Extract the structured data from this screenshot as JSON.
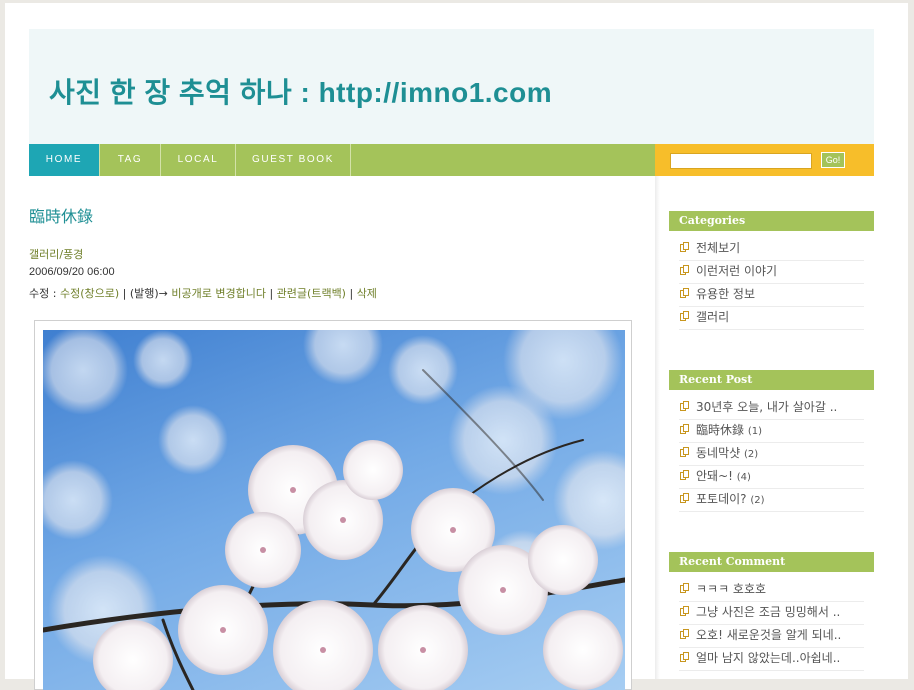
{
  "site": {
    "title": "사진 한 장 추억 하나 : http://imno1.com"
  },
  "nav": {
    "items": [
      {
        "label": "HOME",
        "active": true
      },
      {
        "label": "TAG",
        "active": false
      },
      {
        "label": "LOCAL",
        "active": false
      },
      {
        "label": "GUEST BOOK",
        "active": false
      }
    ]
  },
  "search": {
    "value": "",
    "button_label": "Go!"
  },
  "post": {
    "title": "臨時休錄",
    "category": "갤러리/풍경",
    "date": "2006/09/20 06:00",
    "actions": {
      "edit_prefix": "수정 : ",
      "edit_popup": "수정(창으로)",
      "sep1": " | ",
      "hidden_prefix": "(발행)→ ",
      "make_private": "비공개로 변경합니다",
      "sep2": " | ",
      "trackback": "관련글(트랙백)",
      "sep3": " | ",
      "delete": "삭제"
    }
  },
  "sidebar": {
    "categories": {
      "heading": "Categories",
      "items": [
        {
          "label": "전체보기"
        },
        {
          "label": "이런저런 이야기"
        },
        {
          "label": "유용한 정보"
        },
        {
          "label": "갤러리"
        }
      ]
    },
    "recent_post": {
      "heading": "Recent Post",
      "items": [
        {
          "label": "30년후 오늘, 내가 살아갈 ..",
          "count": ""
        },
        {
          "label": "臨時休錄",
          "count": "(1)"
        },
        {
          "label": "동네막샷",
          "count": "(2)"
        },
        {
          "label": "안돼~!",
          "count": "(4)"
        },
        {
          "label": "포토데이?",
          "count": "(2)"
        }
      ]
    },
    "recent_comment": {
      "heading": "Recent Comment",
      "items": [
        {
          "label": "ㅋㅋㅋ 호호호"
        },
        {
          "label": "그냥 사진은 조금 밍밍해서 .."
        },
        {
          "label": "오호! 새로운것을 알게 되네.."
        },
        {
          "label": "얼마 남지 않았는데..아쉽네.."
        }
      ]
    }
  },
  "colors": {
    "accent_teal": "#1e8f94",
    "nav_green": "#a4c35a",
    "nav_active": "#1ea6b4",
    "search_yellow": "#f7be2a"
  }
}
